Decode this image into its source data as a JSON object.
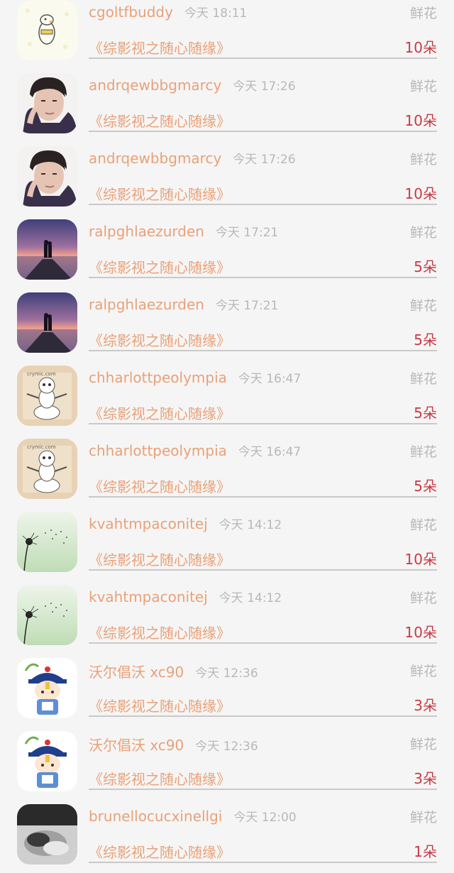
{
  "gift_label": "鲜花",
  "rows": [
    {
      "user": "cgoltfbuddy",
      "time": "今天 18:11",
      "gift": "鲜花",
      "book": "《综影视之随心随缘》",
      "amount": "10朵",
      "avatar": "chick"
    },
    {
      "user": "andrqewbbgmarcy",
      "time": "今天 17:26",
      "gift": "鲜花",
      "book": "《综影视之随心随缘》",
      "amount": "10朵",
      "avatar": "man"
    },
    {
      "user": "andrqewbbgmarcy",
      "time": "今天 17:26",
      "gift": "鲜花",
      "book": "《综影视之随心随缘》",
      "amount": "10朵",
      "avatar": "man"
    },
    {
      "user": "ralpghlaezurden",
      "time": "今天 17:21",
      "gift": "鲜花",
      "book": "《综影视之随心随缘》",
      "amount": "5朵",
      "avatar": "sunset"
    },
    {
      "user": "ralpghlaezurden",
      "time": "今天 17:21",
      "gift": "鲜花",
      "book": "《综影视之随心随缘》",
      "amount": "5朵",
      "avatar": "sunset"
    },
    {
      "user": "chharlottpeolympia",
      "time": "今天 16:47",
      "gift": "鲜花",
      "book": "《综影视之随心随缘》",
      "amount": "5朵",
      "avatar": "cartoon"
    },
    {
      "user": "chharlottpeolympia",
      "time": "今天 16:47",
      "gift": "鲜花",
      "book": "《综影视之随心随缘》",
      "amount": "5朵",
      "avatar": "cartoon"
    },
    {
      "user": "kvahtmpaconitej",
      "time": "今天 14:12",
      "gift": "鲜花",
      "book": "《综影视之随心随缘》",
      "amount": "10朵",
      "avatar": "dandelion"
    },
    {
      "user": "kvahtmpaconitej",
      "time": "今天 14:12",
      "gift": "鲜花",
      "book": "《综影视之随心随缘》",
      "amount": "10朵",
      "avatar": "dandelion"
    },
    {
      "user": "沃尔倡沃 xc90",
      "time": "今天 12:36",
      "gift": "鲜花",
      "book": "《综影视之随心随缘》",
      "amount": "3朵",
      "avatar": "qing"
    },
    {
      "user": "沃尔倡沃 xc90",
      "time": "今天 12:36",
      "gift": "鲜花",
      "book": "《综影视之随心随缘》",
      "amount": "3朵",
      "avatar": "qing"
    },
    {
      "user": "brunellocucxinellgi",
      "time": "今天 12:00",
      "gift": "鲜花",
      "book": "《综影视之随心随缘》",
      "amount": "1朵",
      "avatar": "bw"
    }
  ],
  "colors": {
    "name": "#e9a178",
    "time": "#b8b8b8",
    "amount": "#c83a45",
    "background": "#f5f5f5"
  }
}
